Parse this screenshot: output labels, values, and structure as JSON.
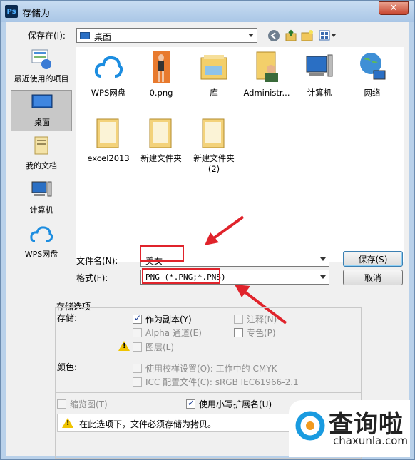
{
  "window": {
    "title": "存储为",
    "app_icon": "Ps"
  },
  "save_in": {
    "label": "保存在(I):",
    "value": "桌面"
  },
  "sidebar": [
    {
      "name": "recent",
      "label": "最近使用的项目"
    },
    {
      "name": "desktop",
      "label": "桌面",
      "selected": true
    },
    {
      "name": "documents",
      "label": "我的文档"
    },
    {
      "name": "computer",
      "label": "计算机"
    },
    {
      "name": "wps",
      "label": "WPS网盘"
    }
  ],
  "files": [
    {
      "label": "WPS网盘",
      "icon": "cloud-icon"
    },
    {
      "label": "0.png",
      "icon": "image-file-icon"
    },
    {
      "label": "库",
      "icon": "library-icon"
    },
    {
      "label": "Administr...",
      "icon": "user-folder-icon"
    },
    {
      "label": "计算机",
      "icon": "computer-icon"
    },
    {
      "label": "网络",
      "icon": "network-icon"
    },
    {
      "label": "excel2013",
      "icon": "folder-icon"
    },
    {
      "label": "新建文件夹",
      "icon": "folder-icon"
    },
    {
      "label": "新建文件夹\n(2)",
      "icon": "folder-icon"
    }
  ],
  "filename": {
    "label": "文件名(N):",
    "value": "美女"
  },
  "format": {
    "label": "格式(F):",
    "value": "PNG (*.PNG;*.PNS)"
  },
  "buttons": {
    "save": "保存(S)",
    "cancel": "取消"
  },
  "options": {
    "group_title": "存储选项",
    "save_label": "存储:",
    "as_copy": "作为副本(Y)",
    "alpha": "Alpha 通道(E)",
    "layers": "图层(L)",
    "notes": "注释(N)",
    "spot": "专色(P)",
    "color_label": "颜色:",
    "proof": "使用校样设置(O):  工作中的 CMYK",
    "icc": "ICC 配置文件(C):  sRGB IEC61966-2.1",
    "thumbnail": "缩览图(T)",
    "lowercase": "使用小写扩展名(U)",
    "warning": "在此选项下，文件必须存储为拷贝。"
  },
  "watermark": {
    "brand": "查询啦",
    "url": "chaxunla.com"
  },
  "colors": {
    "highlight": "#e0232b",
    "accent": "#1a9be0"
  }
}
